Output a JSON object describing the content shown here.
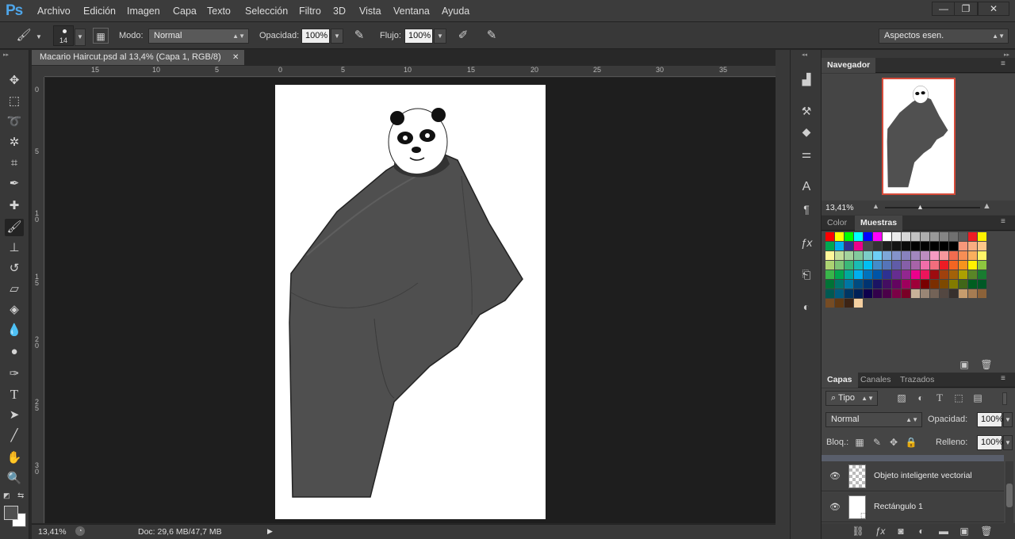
{
  "app": {
    "logo": "Ps"
  },
  "menu": [
    "Archivo",
    "Edición",
    "Imagen",
    "Capa",
    "Texto",
    "Selección",
    "Filtro",
    "3D",
    "Vista",
    "Ventana",
    "Ayuda"
  ],
  "window_buttons": [
    "—",
    "❐",
    "✕"
  ],
  "options": {
    "brush_size": "14",
    "mode_label": "Modo:",
    "mode_value": "Normal",
    "opacity_label": "Opacidad:",
    "opacity_value": "100%",
    "flow_label": "Flujo:",
    "flow_value": "100%",
    "workspace_value": "Aspectos esen."
  },
  "document": {
    "tab_title": "Macario Haircut.psd al 13,4% (Capa 1, RGB/8)",
    "close": "✕",
    "ruler_h": [
      "15",
      "10",
      "5",
      "0",
      "5",
      "10",
      "15",
      "20",
      "25",
      "30",
      "35"
    ],
    "ruler_v": [
      "0",
      "5",
      "1\n0",
      "1\n5",
      "2\n0",
      "2\n5",
      "3\n0"
    ]
  },
  "status": {
    "zoom": "13,41%",
    "doc_info": "Doc: 29,6 MB/47,7 MB"
  },
  "navigator": {
    "title": "Navegador",
    "zoom": "13,41%"
  },
  "swatches_panel": {
    "tabs": [
      "Color",
      "Muestras"
    ],
    "active_tab": "Muestras",
    "rows": [
      [
        "#ff0000",
        "#ffff00",
        "#00ff00",
        "#00ffff",
        "#0000ff",
        "#ff00ff",
        "#ffffff",
        "#ebebeb",
        "#d6d6d6",
        "#c2c2c2",
        "#adadad",
        "#999999",
        "#858585",
        "#707070",
        "#5c5c5c",
        "#ed1c24",
        "#fff200"
      ],
      [
        "#00a651",
        "#00aeef",
        "#2e3192",
        "#ec008c",
        "#474747",
        "#333333",
        "#1f1f1f",
        "#141414",
        "#0a0a0a",
        "#000000",
        "#000000",
        "#000000",
        "#000000",
        "#000000",
        "#f7977a",
        "#f9ad81",
        "#fdc68a"
      ],
      [
        "#fff79a",
        "#c4df9b",
        "#a3d39c",
        "#82ca9d",
        "#7bcdc8",
        "#6ecff6",
        "#7ea7d8",
        "#8493ca",
        "#8882be",
        "#a187be",
        "#bc8dbf",
        "#f49ac2",
        "#f6989d",
        "#f26c4f",
        "#f68e55",
        "#fbaf5d",
        "#fff467"
      ],
      [
        "#acd372",
        "#7cc576",
        "#3bb878",
        "#1abbb4",
        "#00bff3",
        "#438ccb",
        "#5574b9",
        "#605ca8",
        "#855fa8",
        "#a763a8",
        "#f06ea9",
        "#f26d7d",
        "#ed1c24",
        "#f26522",
        "#f7941d",
        "#fff200",
        "#8dc63f"
      ],
      [
        "#39b54a",
        "#00a651",
        "#00a99d",
        "#00aeef",
        "#0072bc",
        "#0054a6",
        "#2e3192",
        "#662d91",
        "#92278f",
        "#ec008c",
        "#ed145b",
        "#9e0b0f",
        "#a0410d",
        "#a36209",
        "#aba000",
        "#598527",
        "#197b30"
      ],
      [
        "#007236",
        "#00746b",
        "#0076a3",
        "#004b80",
        "#003471",
        "#1b1464",
        "#440e62",
        "#630460",
        "#9e005d",
        "#9e0039",
        "#790000",
        "#7b2e00",
        "#7d4900",
        "#827b00",
        "#406618",
        "#005e20",
        "#005826"
      ],
      [
        "#005952",
        "#005b7f",
        "#003663",
        "#002157",
        "#0d004c",
        "#32004b",
        "#4b0049",
        "#7b0046",
        "#7a0026",
        "#c7b299",
        "#998675",
        "#736357",
        "#534741",
        "#37302d",
        "#c69c6d",
        "#a67c52",
        "#8c6239"
      ],
      [
        "#754c24",
        "#603913",
        "#3c2415",
        "#f5cfa0"
      ]
    ]
  },
  "layers_panel": {
    "tabs": [
      "Capas",
      "Canales",
      "Trazados"
    ],
    "active_tab": "Capas",
    "filter_label": "Tipo",
    "blend_mode": "Normal",
    "opacity_label": "Opacidad:",
    "opacity_value": "100%",
    "lock_label": "Bloq.:",
    "fill_label": "Relleno:",
    "fill_value": "100%",
    "layers": [
      {
        "name": "Objeto inteligente vectorial"
      },
      {
        "name": "Rectángulo 1"
      }
    ]
  },
  "icons": {
    "eye": "visibility-eye-icon"
  }
}
